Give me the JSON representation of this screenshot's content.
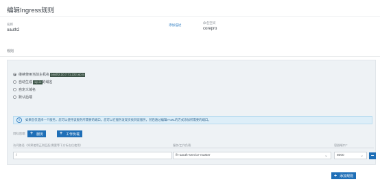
{
  "page": {
    "title": "编辑Ingress规则"
  },
  "header": {
    "name_label": "名称",
    "name_value": "oauth2",
    "add_desc_link": "添加描述",
    "namespace_label": "命名空间",
    "namespace_value": "corepro"
  },
  "rules": {
    "section_label": "规则",
    "radios": [
      {
        "label": "继续使用当前主机名",
        "masked": "oauth2.10.7.71.222.xip.io",
        "suffix": "",
        "checked": true
      },
      {
        "label": "自动生成",
        "masked": ".xip.io",
        "suffix": "的域名",
        "checked": false
      },
      {
        "label": "自定义域名",
        "masked": "",
        "suffix": "",
        "checked": false
      },
      {
        "label": "默认后端",
        "masked": "",
        "suffix": "",
        "checked": false
      }
    ],
    "info_text": "如果您仅选择一个服务，您可以使用该服务所需要的端口。您可以在服务发现页找到该服务，然后通过编辑YAML的方式添加所需要的端口。",
    "target_label": "目标后端",
    "add_service_label": "服务",
    "add_workload_label": "工作负载",
    "columns": {
      "path": "访问路径（如果使用正则匹配,需要等下方标志位使用）",
      "target": "服务/工作负载",
      "port": "容器端口 *"
    },
    "row": {
      "path_value": "/",
      "target_value": "fh-oauth-service-master",
      "port_value": "8000"
    },
    "add_rule_label": "添加规则"
  },
  "colors": {
    "primary": "#1f6fb7",
    "link": "#3d86c6",
    "panel_bg": "#eef2f5",
    "info_bg": "#ddeef8"
  }
}
